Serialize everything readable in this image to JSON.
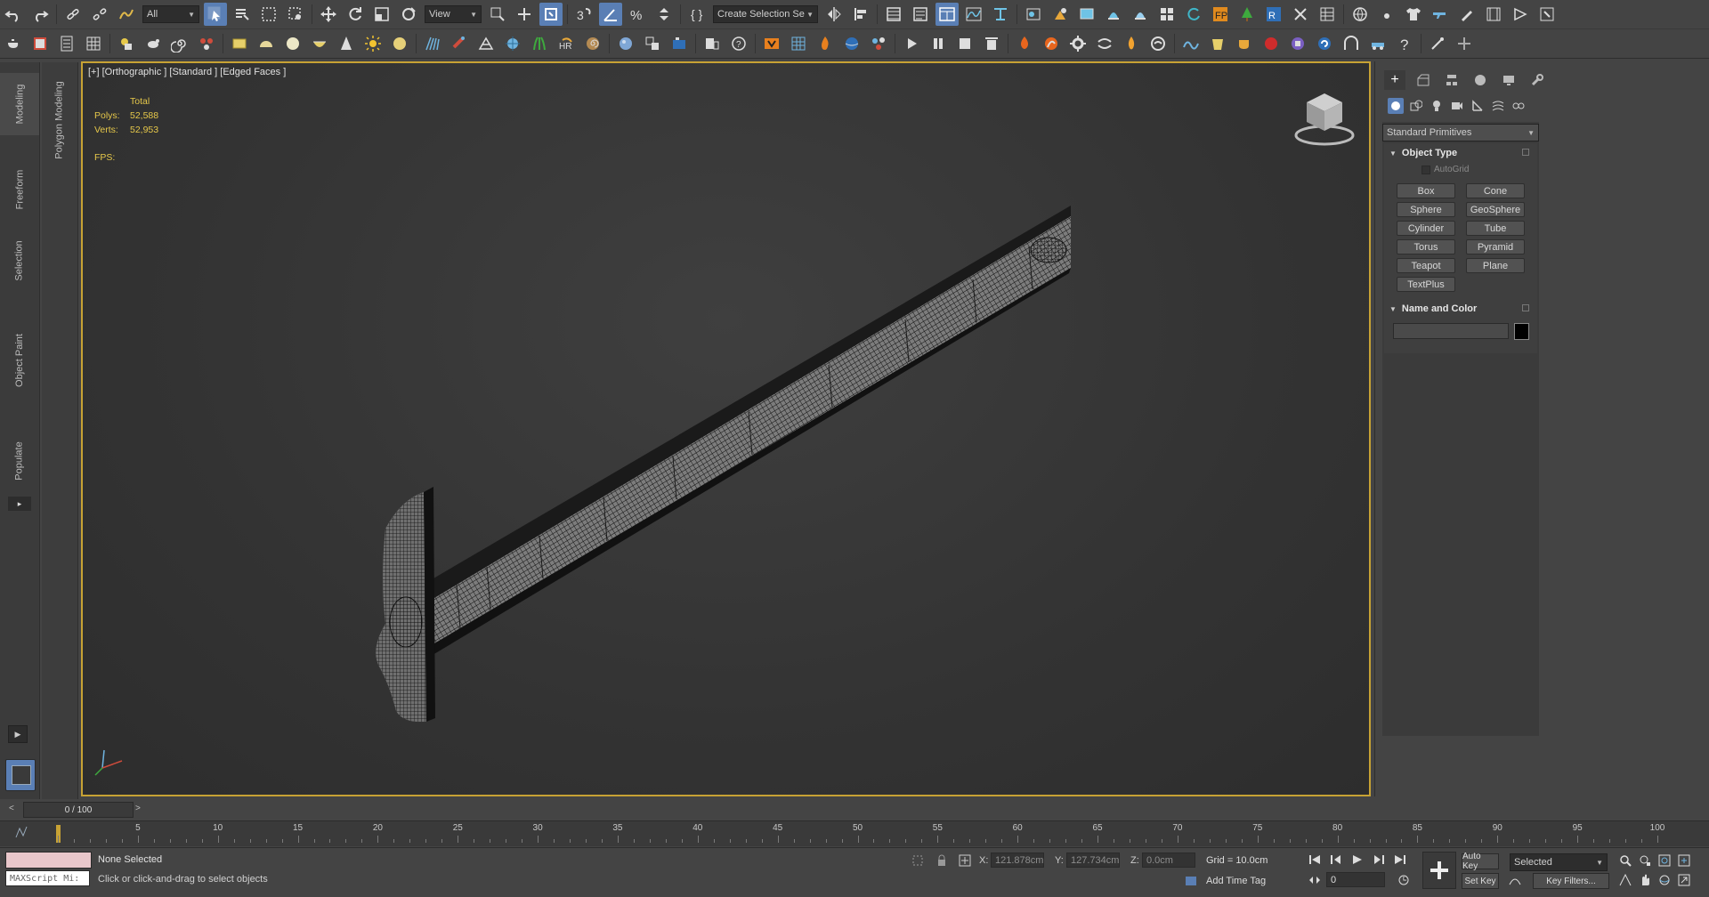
{
  "toolbar_main": {
    "selection_filter": "All",
    "ref_coord": "View",
    "named_selection": "Create Selection Se"
  },
  "ribbon_tabs": [
    "Modeling",
    "Freeform",
    "Selection",
    "Object Paint",
    "Populate"
  ],
  "ribbon_panel_label": "Polygon Modeling",
  "viewport": {
    "label": "[+] [Orthographic ] [Standard ] [Edged Faces ]",
    "stats": {
      "header": "Total",
      "polys_label": "Polys:",
      "polys_value": "52,588",
      "verts_label": "Verts:",
      "verts_value": "52,953",
      "fps_label": "FPS:"
    }
  },
  "command_panel": {
    "category_dropdown": "Standard Primitives",
    "object_type": {
      "title": "Object Type",
      "autogrid_label": "AutoGrid",
      "buttons": [
        "Box",
        "Cone",
        "Sphere",
        "GeoSphere",
        "Cylinder",
        "Tube",
        "Torus",
        "Pyramid",
        "Teapot",
        "Plane",
        "TextPlus"
      ]
    },
    "name_and_color": {
      "title": "Name and Color",
      "name_value": "",
      "color": "#000000"
    }
  },
  "time_slider": {
    "position": "0 / 100",
    "frame_labels": [
      "5",
      "10",
      "15",
      "20",
      "25",
      "30",
      "35",
      "40",
      "45",
      "50",
      "55",
      "60",
      "65",
      "70",
      "75",
      "80",
      "85",
      "90",
      "95",
      "100"
    ]
  },
  "status_bar": {
    "maxscript_placeholder": "MAXScript Mi:",
    "selection_status": "None Selected",
    "prompt": "Click or click-and-drag to select objects",
    "x_label": "X:",
    "x_value": "121.878cm",
    "y_label": "Y:",
    "y_value": "127.734cm",
    "z_label": "Z:",
    "z_value": "0.0cm",
    "grid": "Grid = 10.0cm",
    "add_time_tag": "Add Time Tag",
    "auto_key": "Auto Key",
    "set_key": "Set Key",
    "key_mode": "Selected",
    "key_filters": "Key Filters...",
    "current_frame": "0"
  },
  "colors": {
    "accent_blue": "#5a7fb5",
    "viewport_border": "#c7a234",
    "stats_yellow": "#e6c84a"
  }
}
